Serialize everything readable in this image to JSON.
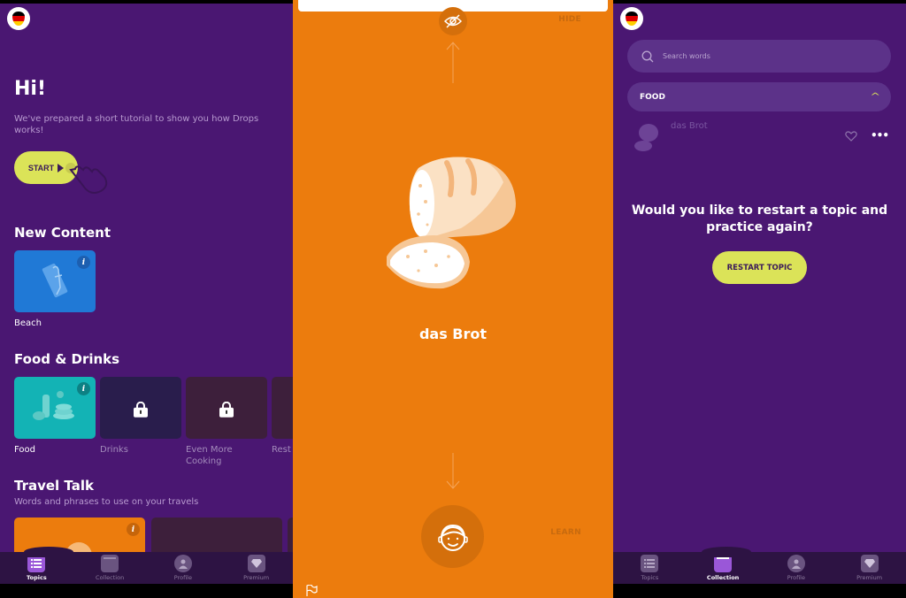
{
  "colors": {
    "purple_bg": "#4a1772",
    "orange_bg": "#ec7c0d",
    "accent_lime": "#dbe358",
    "nav_bg": "#2d1343",
    "active_nav": "#9a57d8"
  },
  "language_flag": "germany-flag",
  "left_screen": {
    "greeting": "Hi!",
    "intro": "We've prepared a short tutorial to show you how Drops works!",
    "start_label": "START",
    "sections": [
      {
        "title": "New Content",
        "cards": [
          {
            "label": "Beach",
            "locked": false,
            "color": "#2079d6",
            "info": true
          }
        ]
      },
      {
        "title": "Food & Drinks",
        "cards": [
          {
            "label": "Food",
            "locked": false,
            "color": "#13b3b5",
            "info": true
          },
          {
            "label": "Drinks",
            "locked": true,
            "color": "#291d4c"
          },
          {
            "label": "Even More Cooking",
            "locked": true,
            "color": "#3d1f3b"
          },
          {
            "label": "Rest",
            "locked": true,
            "color": "#3d1f3b"
          }
        ]
      },
      {
        "title": "Travel Talk",
        "subtitle": "Words and phrases to use on your travels",
        "cards": [
          {
            "label": "",
            "locked": false,
            "color": "#ec7c0d",
            "info": true
          },
          {
            "label": "",
            "locked": true,
            "color": "#3d1f3b"
          }
        ]
      }
    ],
    "nav": [
      {
        "label": "Topics",
        "icon": "list-icon",
        "active": true
      },
      {
        "label": "Collection",
        "icon": "book-icon",
        "active": false
      },
      {
        "label": "Profile",
        "icon": "profile-icon",
        "active": false
      },
      {
        "label": "Premium",
        "icon": "diamond-icon",
        "active": false
      }
    ]
  },
  "middle_screen": {
    "hide_label": "HIDE",
    "word": "das Brot",
    "learn_label": "LEARN"
  },
  "right_screen": {
    "search_placeholder": "Search words",
    "topic": "FOOD",
    "words": [
      {
        "text": "das Brot"
      }
    ],
    "restart_question": "Would you like to restart a topic and practice again?",
    "restart_label": "RESTART TOPIC",
    "nav": [
      {
        "label": "Topics",
        "icon": "list-icon",
        "active": false
      },
      {
        "label": "Collection",
        "icon": "book-icon",
        "active": true
      },
      {
        "label": "Profile",
        "icon": "profile-icon",
        "active": false
      },
      {
        "label": "Premium",
        "icon": "diamond-icon",
        "active": false
      }
    ]
  }
}
